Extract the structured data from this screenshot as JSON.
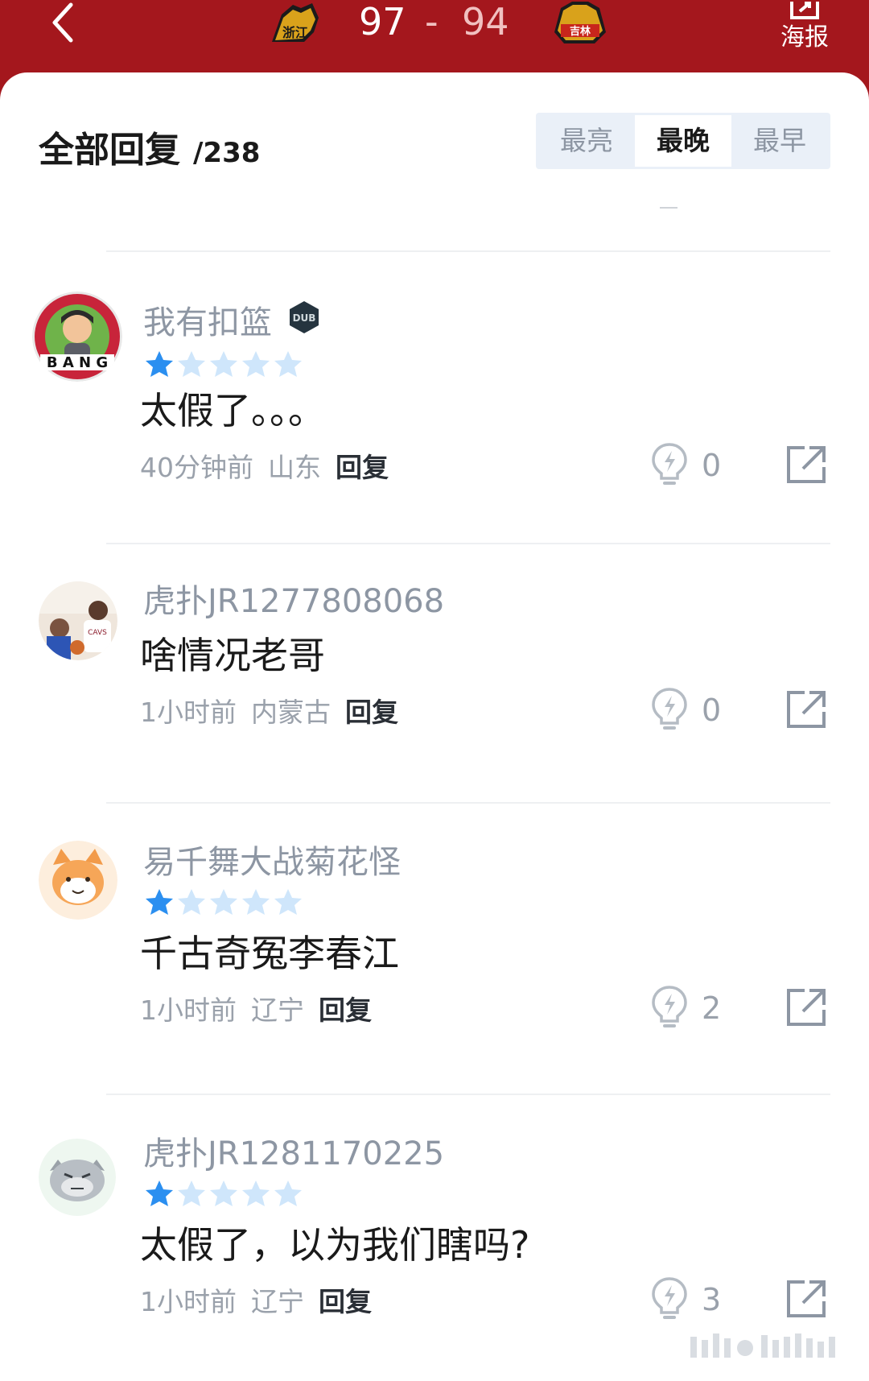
{
  "header": {
    "back": "back",
    "home_score": "97",
    "score_separator": "-",
    "away_score": "94",
    "home_logo_text": "浙江",
    "away_logo_text": "吉林",
    "poster_label": "海报",
    "background_color": "#a4171d"
  },
  "replies": {
    "title": "全部回复",
    "count": "/238"
  },
  "sort_tabs": [
    {
      "label": "最亮",
      "active": false
    },
    {
      "label": "最晚",
      "active": true
    },
    {
      "label": "最早",
      "active": false
    }
  ],
  "comments": [
    {
      "username": "我有扣篮",
      "has_badge": true,
      "stars": 1,
      "text": "太假了。。。",
      "time": "40分钟前",
      "location": "山东",
      "reply_label": "回复",
      "lights": "0"
    },
    {
      "username": "虎扑JR1277808068",
      "has_badge": false,
      "stars": 0,
      "text": "啥情况老哥",
      "time": "1小时前",
      "location": "内蒙古",
      "reply_label": "回复",
      "lights": "0"
    },
    {
      "username": "易千舞大战菊花怪",
      "has_badge": false,
      "stars": 1,
      "text": "千古奇冤李春江",
      "time": "1小时前",
      "location": "辽宁",
      "reply_label": "回复",
      "lights": "2"
    },
    {
      "username": "虎扑JR1281170225",
      "has_badge": false,
      "stars": 1,
      "text": "太假了，以为我们瞎吗?",
      "time": "1小时前",
      "location": "辽宁",
      "reply_label": "回复",
      "lights": "3"
    }
  ],
  "colors": {
    "star_filled": "#2b8ff0",
    "star_empty": "#cfe6fb",
    "muted_text": "#8d96a3"
  }
}
